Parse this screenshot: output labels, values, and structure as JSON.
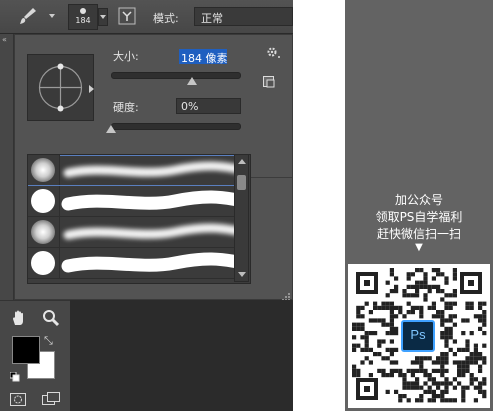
{
  "toolbar": {
    "brush_size": "184",
    "mode_label": "模式:",
    "mode_value": "正常"
  },
  "brush_panel": {
    "size_label": "大小:",
    "size_value": "184 像素",
    "size_level": 0.63,
    "hardness_label": "硬度:",
    "hardness_value": "0%",
    "hardness_level": 0.0,
    "presets": [
      {
        "type": "soft"
      },
      {
        "type": "hard"
      },
      {
        "type": "soft"
      },
      {
        "type": "hard"
      }
    ]
  },
  "tools": {
    "foreground_color": "#000000",
    "background_color": "#ffffff"
  },
  "promo": {
    "line1": "加公众号",
    "line2": "领取PS自学福利",
    "line3": "赶快微信扫一扫",
    "arrow": "▼",
    "qr_center": "Ps"
  }
}
